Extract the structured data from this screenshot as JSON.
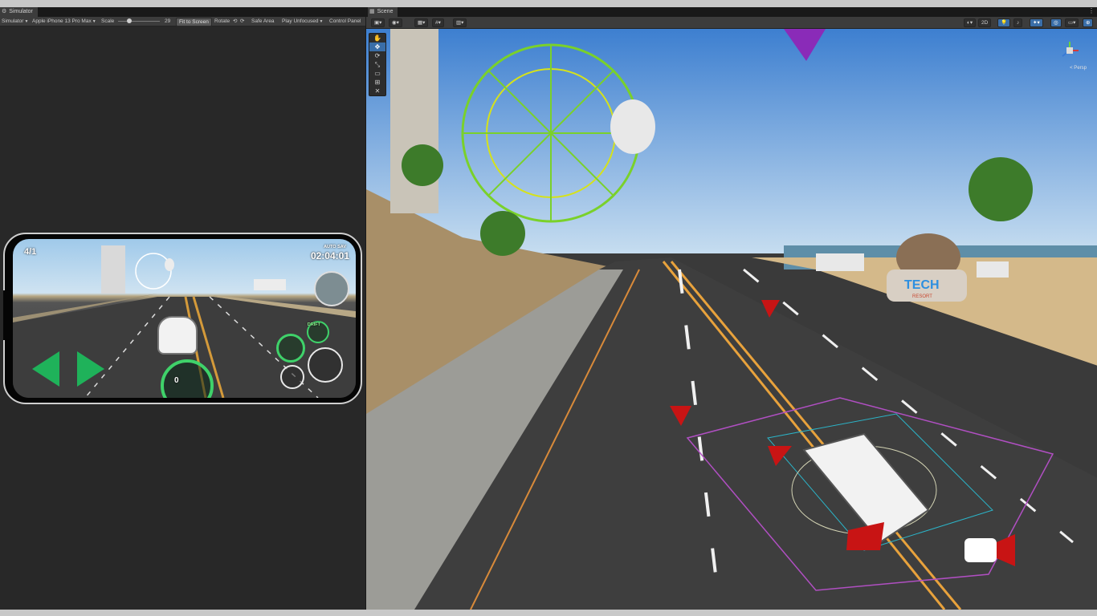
{
  "simulator": {
    "tab_title": "Simulator",
    "toolbar": {
      "mode": "Simulator",
      "device": "Apple iPhone 13 Pro Max",
      "scale_label": "Scale",
      "scale_value": "29",
      "fit_button": "Fit to Screen",
      "rotate_label": "Rotate",
      "safe_area": "Safe Area",
      "play_mode": "Play Unfocused",
      "control_panel": "Control Panel"
    },
    "game_hud": {
      "position": "4/1",
      "auto_save": "AUTO SAV",
      "timer": "02:04:01",
      "drift_label": "DRIFT",
      "speed_value": "0"
    }
  },
  "scene": {
    "tab_title": "Scene",
    "toolbar": {
      "mode_2d": "2D"
    },
    "tools": [
      "hand-tool",
      "move-tool",
      "rotate-tool",
      "scale-tool",
      "rect-tool",
      "transform-tool",
      "custom-tool"
    ],
    "perspective_label": "< Persp",
    "sign_text": "TECH",
    "sign_subtext": "RESORT"
  },
  "colors": {
    "editor_bg": "#282828",
    "toolbar_bg": "#3c3c3c",
    "accent_blue": "#3a6ea8",
    "hud_green": "#3fd26a",
    "gizmo_red": "#c81414"
  }
}
